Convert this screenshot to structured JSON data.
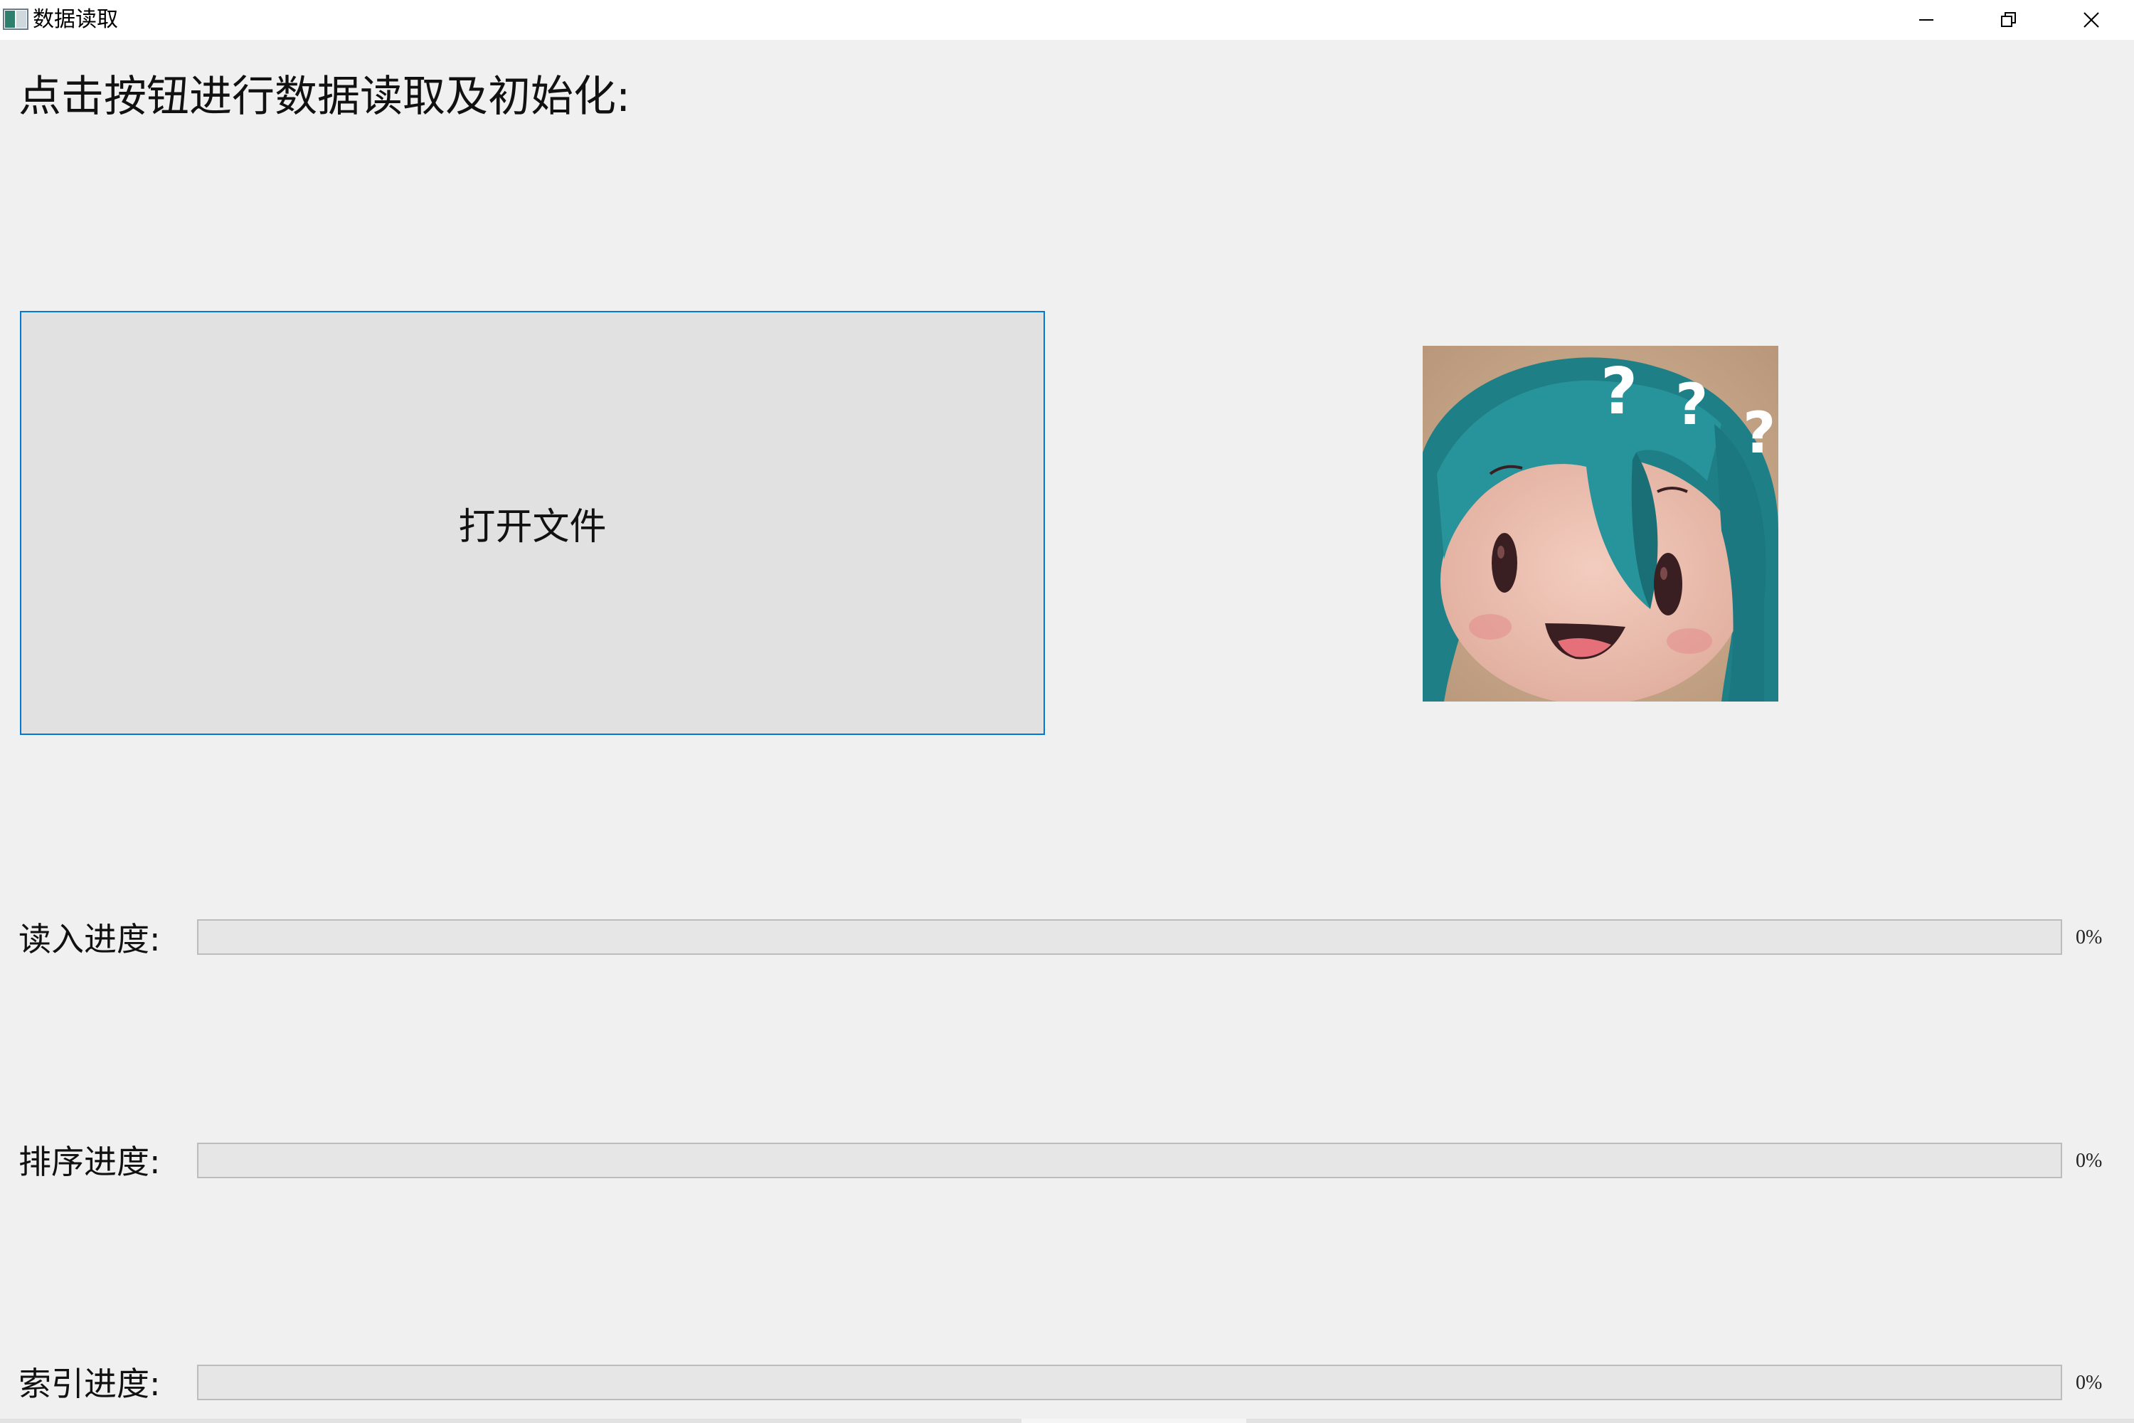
{
  "window": {
    "title": "数据读取"
  },
  "main": {
    "heading": "点击按钮进行数据读取及初始化:",
    "open_button_label": "打开文件"
  },
  "progress": {
    "read": {
      "label": "读入进度:",
      "percent_text": "0%",
      "value": 0
    },
    "sort": {
      "label": "排序进度:",
      "percent_text": "0%",
      "value": 0
    },
    "index": {
      "label": "索引进度:",
      "percent_text": "0%",
      "value": 0
    }
  },
  "colors": {
    "accent": "#0078d7",
    "background": "#f0f0f0",
    "button_face": "#e1e1e1",
    "progress_fill": "#06b025"
  },
  "icons": {
    "app": "app-window-icon",
    "minimize": "minimize-icon",
    "restore": "restore-icon",
    "close": "close-icon",
    "picture": "confused-plush-doll-picture"
  }
}
